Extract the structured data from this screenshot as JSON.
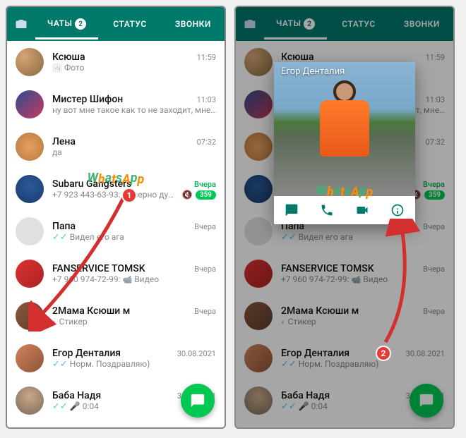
{
  "tabs": {
    "chats": "ЧАТЫ",
    "status": "СТАТУС",
    "calls": "ЗВОНКИ",
    "badge": "2"
  },
  "chats": [
    {
      "name": "Ксюша",
      "time": "11:59",
      "preview": "Фото",
      "icon": "photo",
      "ticks": ""
    },
    {
      "name": "Мистер Шифон",
      "time": "11:03",
      "preview": "ну вот мне такое как то не заходит, мне...",
      "icon": "",
      "ticks": ""
    },
    {
      "name": "Лена",
      "time": "07:32",
      "preview": "да",
      "icon": "",
      "ticks": ""
    },
    {
      "name": "Subaru Gangsters",
      "time": "Вчера",
      "preview": "+7 923 443-63-93: Наверно дума...",
      "icon": "",
      "ticks": "",
      "green": true,
      "muted": true,
      "unread": "359"
    },
    {
      "name": "Папа",
      "time": "Вчера",
      "preview": "Видел его ага",
      "icon": "",
      "ticks": "blue"
    },
    {
      "name": "FANSERVICE TOMSK",
      "time": "Вчера",
      "preview": "+7 960 974-72-99:",
      "preview2": "Видео",
      "icon": "video",
      "ticks": ""
    },
    {
      "name": "2Мама Ксюши м",
      "time": "Вчера",
      "preview": "Стикер",
      "icon": "sticker",
      "ticks": ""
    },
    {
      "name": "Егор Денталия",
      "time": "30.08.2021",
      "preview": "Норм. Поздравляю)",
      "icon": "",
      "ticks": "blue"
    },
    {
      "name": "Баба Надя",
      "time": "30.08.2021",
      "preview": "0:04",
      "icon": "mic",
      "ticks": "blue",
      "micblue": true
    }
  ],
  "left_variant": {
    "chat5_name": "FANSERVICE TOMSK",
    "chat6_name": "2Мама Ксюши м"
  },
  "popup": {
    "name": "Егор Денталия"
  },
  "badges": {
    "one": "1",
    "two": "2"
  },
  "watermark": "WhatsApp"
}
